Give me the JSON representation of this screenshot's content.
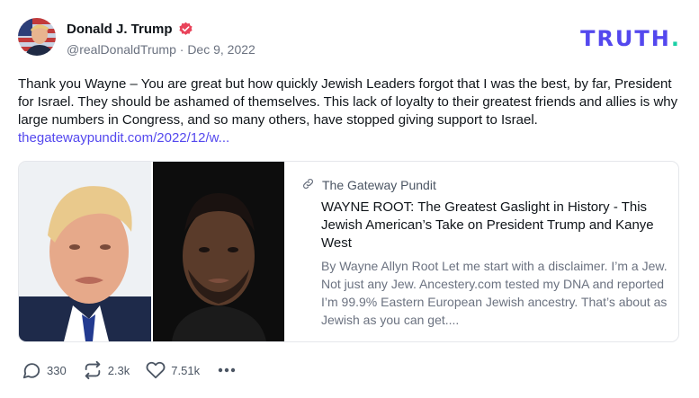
{
  "author": {
    "display_name": "Donald J. Trump",
    "handle": "@realDonaldTrump",
    "separator": " · ",
    "date": "Dec 9, 2022"
  },
  "logo": {
    "text": "TRUTH",
    "dot": "."
  },
  "post": {
    "text": "Thank you Wayne – You are great but how quickly Jewish Leaders forgot that I was the best, by far, President for Israel. They should be ashamed of themselves. This lack of loyalty to their greatest friends and allies is why large numbers in Congress, and so many others, have stopped giving support to Israel.",
    "link_text": "thegatewaypundit.com/2022/12/w..."
  },
  "card": {
    "source": "The Gateway Pundit",
    "title": "WAYNE ROOT: The Greatest Gaslight in History - This Jewish American’s Take on President Trump and Kanye West",
    "description": "By Wayne Allyn Root Let me start with a disclaimer. I’m a Jew. Not just any Jew. Ancestery.com tested my DNA and reported I’m 99.9% Eastern European Jewish ancestry. That’s about as Jewish as you can get...."
  },
  "actions": {
    "replies": "330",
    "retruths": "2.3k",
    "likes": "7.51k"
  },
  "colors": {
    "brand": "#5448ee",
    "brand_dot": "#1bd0a6",
    "verified": "#e9435a",
    "muted": "#6b7280"
  }
}
